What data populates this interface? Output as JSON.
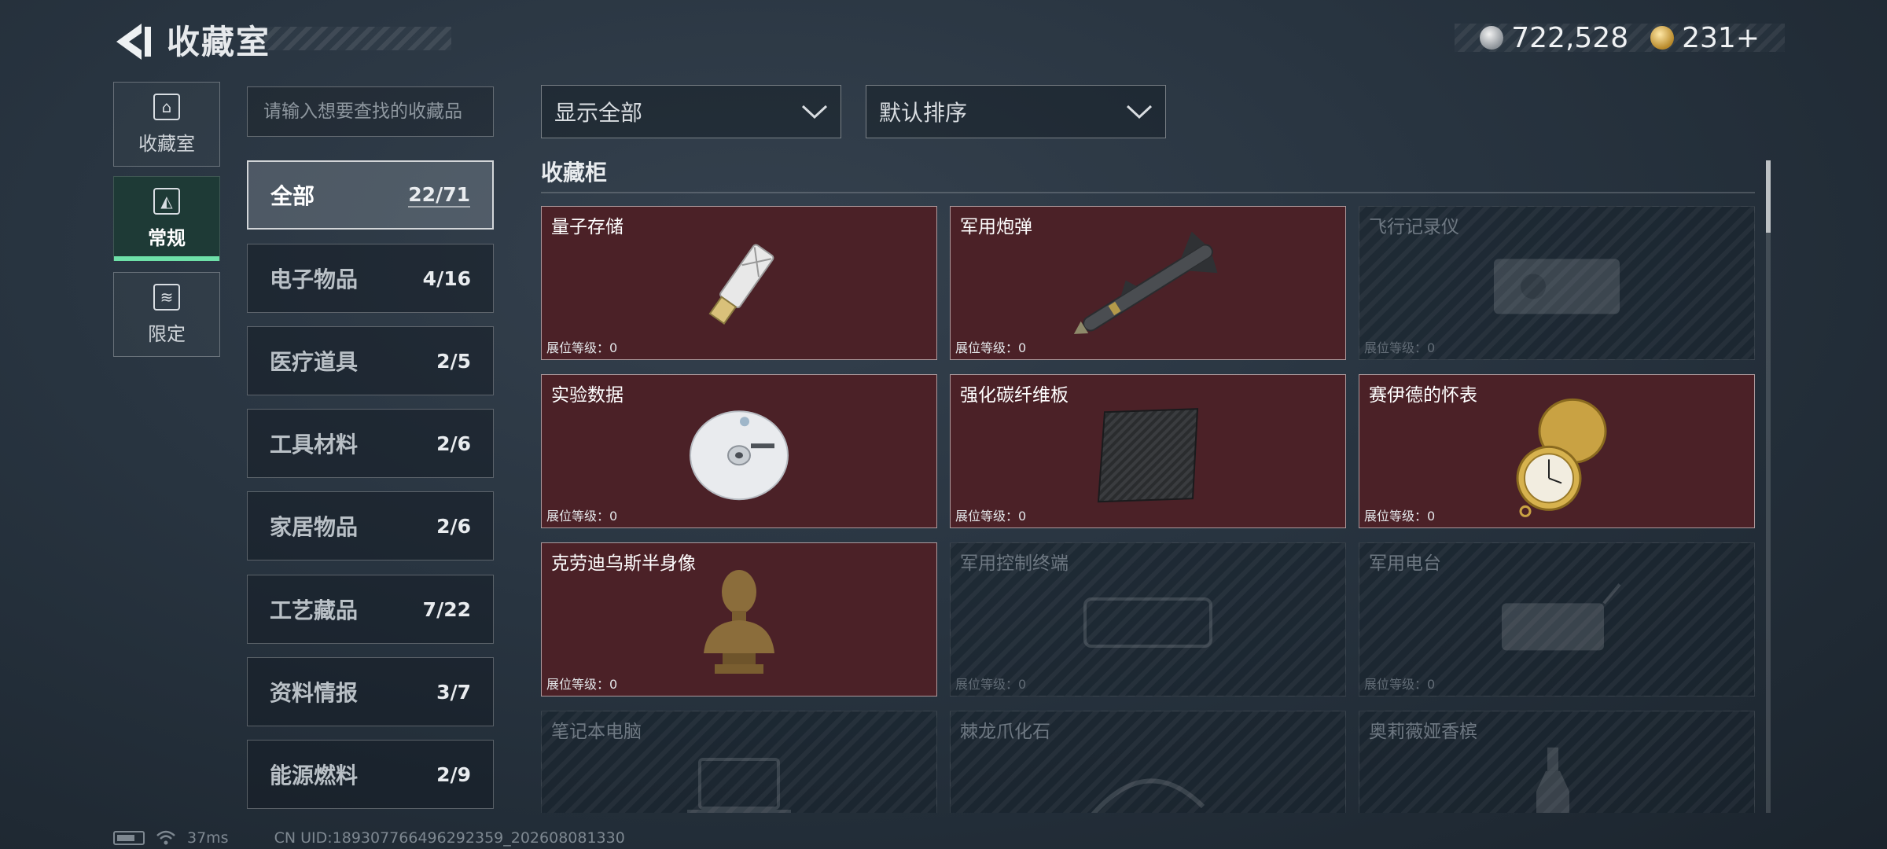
{
  "header": {
    "title": "收藏室",
    "currencies": [
      {
        "icon": "silver-coin-icon",
        "value": "722,528"
      },
      {
        "icon": "gold-coin-icon",
        "value": "231+"
      }
    ]
  },
  "nav": [
    {
      "label": "收藏室",
      "icon": "collection-room-icon",
      "active": false
    },
    {
      "label": "常规",
      "icon": "regular-icon",
      "active": true
    },
    {
      "label": "限定",
      "icon": "limited-icon",
      "active": false
    }
  ],
  "search": {
    "placeholder": "请输入想要查找的收藏品"
  },
  "categories": [
    {
      "name": "全部",
      "count": "22/71",
      "active": true
    },
    {
      "name": "电子物品",
      "count": "4/16"
    },
    {
      "name": "医疗道具",
      "count": "2/5"
    },
    {
      "name": "工具材料",
      "count": "2/6"
    },
    {
      "name": "家居物品",
      "count": "2/6"
    },
    {
      "name": "工艺藏品",
      "count": "7/22"
    },
    {
      "name": "资料情报",
      "count": "3/7"
    },
    {
      "name": "能源燃料",
      "count": "2/9"
    }
  ],
  "filters": {
    "display": "显示全部",
    "sort": "默认排序"
  },
  "section_title": "收藏柜",
  "items": [
    {
      "name": "量子存储",
      "level": "展位等级：0",
      "unlocked": true,
      "icon": "usb-drive-icon"
    },
    {
      "name": "军用炮弹",
      "level": "展位等级：0",
      "unlocked": true,
      "icon": "missile-icon"
    },
    {
      "name": "飞行记录仪",
      "level": "展位等级：0",
      "unlocked": false,
      "icon": "flight-recorder-icon"
    },
    {
      "name": "实验数据",
      "level": "展位等级：0",
      "unlocked": true,
      "icon": "disc-icon"
    },
    {
      "name": "强化碳纤维板",
      "level": "展位等级：0",
      "unlocked": true,
      "icon": "carbon-plate-icon"
    },
    {
      "name": "赛伊德的怀表",
      "level": "展位等级：0",
      "unlocked": true,
      "icon": "pocket-watch-icon"
    },
    {
      "name": "克劳迪乌斯半身像",
      "level": "展位等级：0",
      "unlocked": true,
      "icon": "bust-icon"
    },
    {
      "name": "军用控制终端",
      "level": "展位等级：0",
      "unlocked": false,
      "icon": "control-terminal-icon"
    },
    {
      "name": "军用电台",
      "level": "展位等级：0",
      "unlocked": false,
      "icon": "radio-icon"
    },
    {
      "name": "笔记本电脑",
      "level": "",
      "unlocked": false,
      "icon": "laptop-icon"
    },
    {
      "name": "棘龙爪化石",
      "level": "",
      "unlocked": false,
      "icon": "fossil-icon"
    },
    {
      "name": "奥莉薇娅香槟",
      "level": "",
      "unlocked": false,
      "icon": "champagne-icon"
    }
  ],
  "status": {
    "ping": "37ms",
    "uid": "CN UID:189307766496292359_202608081330"
  }
}
